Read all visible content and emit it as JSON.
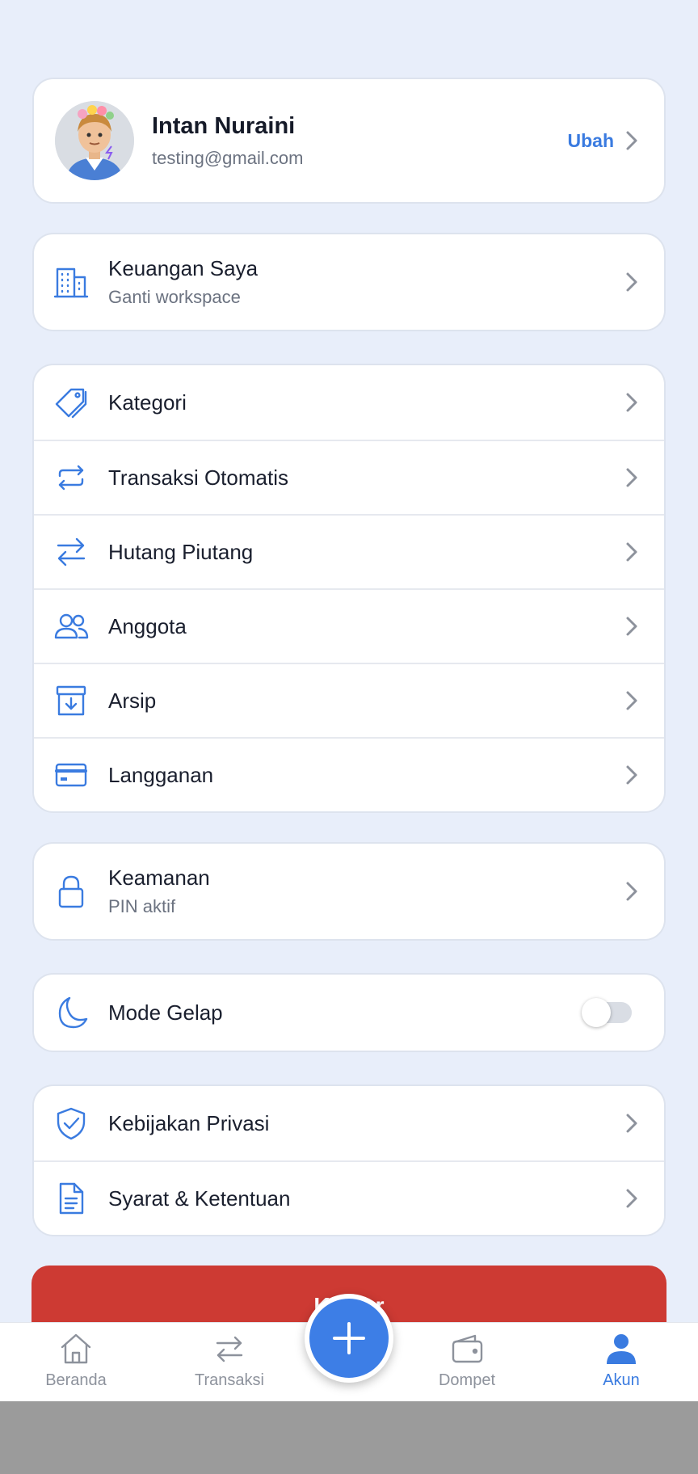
{
  "profile": {
    "name": "Intan Nuraini",
    "email": "testing@gmail.com",
    "edit_label": "Ubah"
  },
  "workspace": {
    "title": "Keuangan Saya",
    "subtitle": "Ganti workspace"
  },
  "menu": {
    "items": [
      {
        "label": "Kategori",
        "icon": "tag-icon"
      },
      {
        "label": "Transaksi Otomatis",
        "icon": "repeat-icon"
      },
      {
        "label": "Hutang Piutang",
        "icon": "swap-arrows-icon"
      },
      {
        "label": "Anggota",
        "icon": "users-icon"
      },
      {
        "label": "Arsip",
        "icon": "archive-icon"
      },
      {
        "label": "Langganan",
        "icon": "credit-card-icon"
      }
    ]
  },
  "security": {
    "title": "Keamanan",
    "subtitle": "PIN aktif"
  },
  "dark_mode": {
    "label": "Mode Gelap",
    "enabled": false
  },
  "legal": {
    "items": [
      {
        "label": "Kebijakan Privasi",
        "icon": "shield-check-icon"
      },
      {
        "label": "Syarat & Ketentuan",
        "icon": "document-icon"
      }
    ]
  },
  "logout": {
    "label": "Keluar"
  },
  "bottom_nav": {
    "items": [
      {
        "label": "Beranda",
        "icon": "home-icon"
      },
      {
        "label": "Transaksi",
        "icon": "swap-arrows-icon"
      },
      {
        "label": "Dompet",
        "icon": "wallet-icon"
      },
      {
        "label": "Akun",
        "icon": "user-icon",
        "active": true
      }
    ],
    "fab_icon": "plus-icon"
  },
  "colors": {
    "accent": "#3a7be0",
    "danger": "#cd3a33",
    "background": "#e8eefa"
  }
}
